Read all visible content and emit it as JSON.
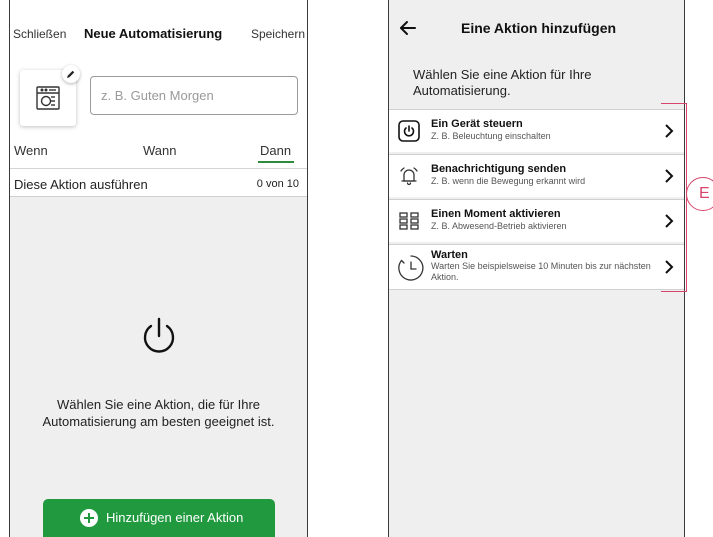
{
  "automation_screen": {
    "header": {
      "close": "Schließen",
      "title": "Neue Automatisierung",
      "save": "Speichern"
    },
    "name_input": {
      "placeholder": "z. B. Guten Morgen",
      "value": ""
    },
    "tabs": [
      {
        "label": "Wenn",
        "active": false
      },
      {
        "label": "Wann",
        "active": false
      },
      {
        "label": "Dann",
        "active": true
      }
    ],
    "action_row": {
      "label": "Diese Aktion ausführen",
      "count": "0 von 10"
    },
    "empty_state": {
      "icon": "power-icon",
      "text": "Wählen Sie eine Aktion, die für Ihre Automatisierung am besten geeignet ist."
    },
    "add_button": {
      "label": "Hinzufügen einer Aktion",
      "color": "#219a3f"
    }
  },
  "action_screen": {
    "header": {
      "title": "Eine Aktion hinzufügen"
    },
    "intro": "Wählen Sie eine Aktion für Ihre Automatisierung.",
    "items": [
      {
        "icon": "power-icon",
        "title": "Ein Gerät steuern",
        "subtitle": "Z. B. Beleuchtung einschalten"
      },
      {
        "icon": "bell-icon",
        "title": "Benachrichtigung senden",
        "subtitle": "Z. B. wenn die Bewegung erkannt wird"
      },
      {
        "icon": "moment-grid-icon",
        "title": "Einen Moment aktivieren",
        "subtitle": "Z. B. Abwesend-Betrieb aktivieren"
      },
      {
        "icon": "timer-icon",
        "title": "Warten",
        "subtitle": "Warten Sie beispielsweise 10 Minuten bis zur nächsten Aktion."
      }
    ]
  },
  "annotation": {
    "label": "E",
    "color": "#d9456a"
  }
}
